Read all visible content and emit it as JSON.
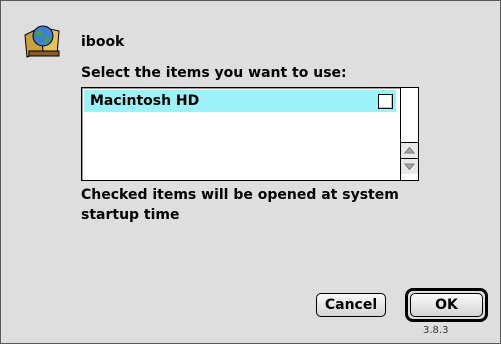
{
  "dialog": {
    "app_name": "ibook",
    "prompt": "Select the items you want to use:",
    "note": "Checked items will be opened at system startup time",
    "version": "3.8.3",
    "icon": "world-book-icon"
  },
  "list": {
    "items": [
      {
        "label": "Macintosh HD",
        "checked": false,
        "selected": true
      }
    ]
  },
  "buttons": {
    "cancel_label": "Cancel",
    "ok_label": "OK"
  },
  "colors": {
    "selection": "#9cf3f7",
    "dialog_bg": "#dedede"
  }
}
